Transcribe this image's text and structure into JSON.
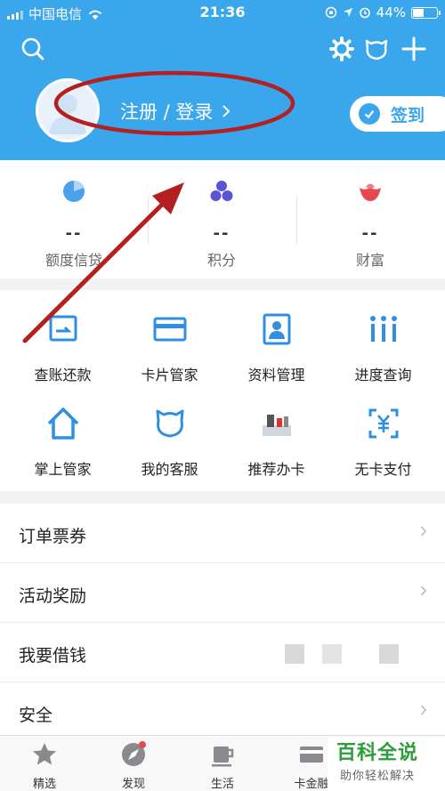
{
  "status_bar": {
    "carrier": "中国电信",
    "time": "21:36",
    "battery": "44%"
  },
  "header": {
    "login": "注册 / 登录",
    "sign_in": "签到"
  },
  "stats": [
    {
      "value": "--",
      "label": "额度信贷",
      "color": "#2f8fe0"
    },
    {
      "value": "--",
      "label": "积分",
      "color": "#5a54d6"
    },
    {
      "value": "--",
      "label": "财富",
      "color": "#e8474f"
    }
  ],
  "grid": [
    {
      "label": "查账还款",
      "icon": "bill-icon"
    },
    {
      "label": "卡片管家",
      "icon": "card-icon"
    },
    {
      "label": "资料管理",
      "icon": "profile-icon"
    },
    {
      "label": "进度查询",
      "icon": "progress-icon"
    },
    {
      "label": "掌上管家",
      "icon": "home-icon"
    },
    {
      "label": "我的客服",
      "icon": "service-icon"
    },
    {
      "label": "推荐办卡",
      "icon": "recommend-icon"
    },
    {
      "label": "无卡支付",
      "icon": "cardless-pay-icon"
    }
  ],
  "list": [
    {
      "label": "订单票券"
    },
    {
      "label": "活动奖励"
    },
    {
      "label": "我要借钱"
    },
    {
      "label": "安全"
    }
  ],
  "tabs": [
    {
      "label": "精选"
    },
    {
      "label": "发现"
    },
    {
      "label": "生活"
    },
    {
      "label": "卡金融"
    }
  ],
  "watermark": {
    "title": "百科全说",
    "subtitle": "助你轻松解决"
  },
  "colors": {
    "accent": "#3aa6ec",
    "annotation": "#b3201f"
  }
}
